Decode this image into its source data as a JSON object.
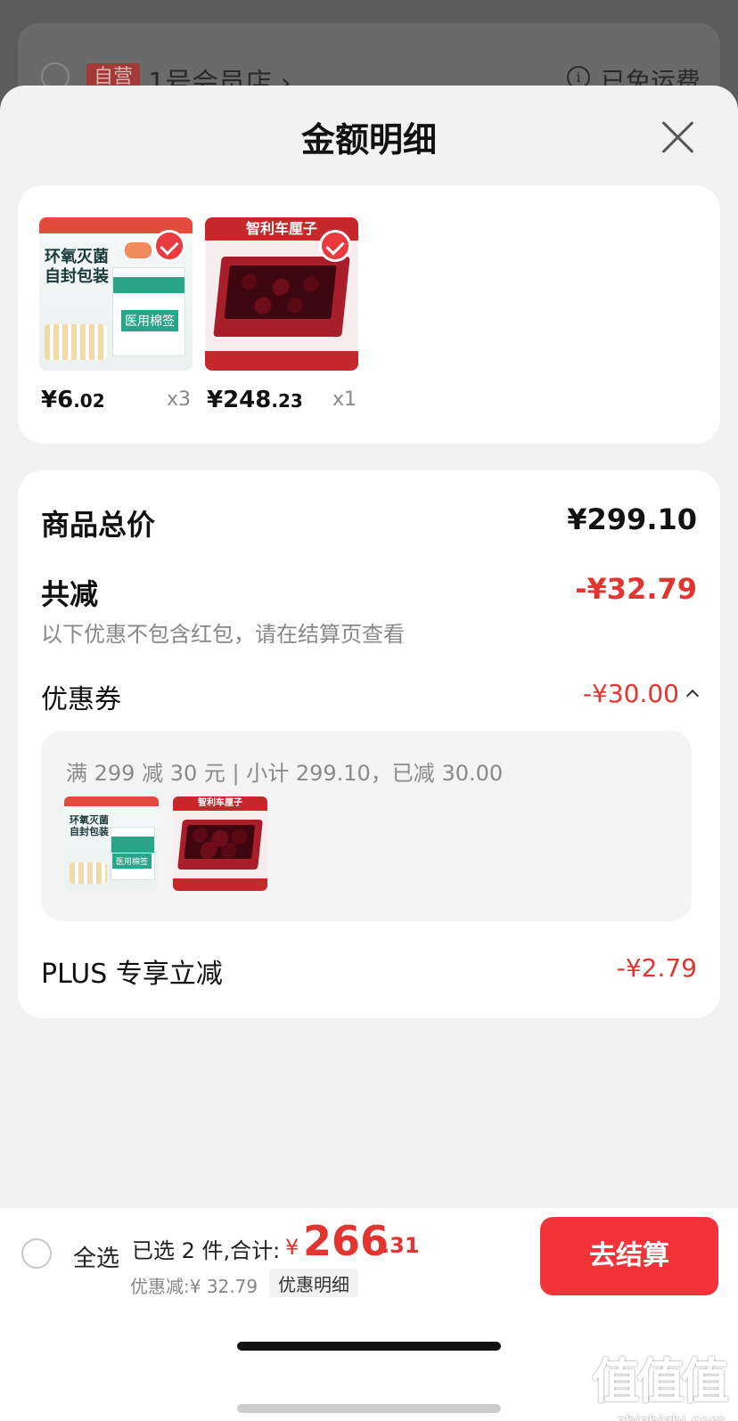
{
  "background": {
    "store_tag": "自营",
    "store_name": "1号会员店",
    "store_chevron": "›",
    "info_glyph": "i",
    "shipping": "已免运费"
  },
  "sheet": {
    "title": "金额明细"
  },
  "products": [
    {
      "name": "医用棉签",
      "image_title": "环氧灭菌\n自封包装",
      "label": "医用棉签",
      "price_int": "¥6",
      "price_dec": ".02",
      "qty": "x3",
      "checked": true
    },
    {
      "name": "智利车厘子",
      "image_title": "智利车厘子",
      "price_int": "¥248",
      "price_dec": ".23",
      "qty": "x1",
      "checked": true
    }
  ],
  "summary": {
    "total_label": "商品总价",
    "total_value": "¥299.10",
    "reduce_label": "共减",
    "reduce_value": "-¥32.79",
    "note": "以下优惠不包含红包，请在结算页查看",
    "coupon_label": "优惠券",
    "coupon_value": "-¥30.00",
    "coupon_detail": "满 299 减 30 元 | 小计 299.10，已减 30.00",
    "plus_label": "PLUS 专享立减",
    "plus_value": "-¥2.79"
  },
  "bottom": {
    "select_all": "全选",
    "selected": "已选 2 件,合计:",
    "currency": "¥",
    "total_int": "266",
    "total_dec": ".31",
    "discount": "优惠减:¥ 32.79",
    "detail_btn": "优惠明细",
    "checkout": "去结算"
  },
  "watermark": {
    "logo": "值值值",
    "url": "zhizhizhi.com"
  },
  "colors": {
    "accent_red": "#e2352f",
    "checkout_bg": "#f0343a",
    "sheet_bg": "#f2f2f2"
  }
}
